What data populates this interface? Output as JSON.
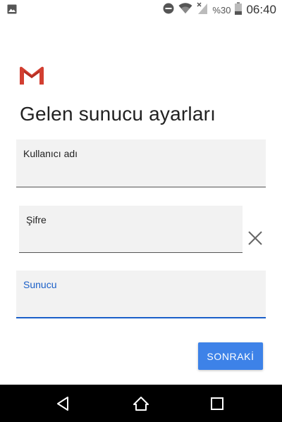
{
  "status_bar": {
    "battery_percent": "%30",
    "time": "06:40",
    "icons": [
      "image-icon",
      "do-not-disturb-icon",
      "wifi-icon",
      "no-signal-icon",
      "battery-icon"
    ]
  },
  "app": {
    "logo": "gmail-logo-icon"
  },
  "page": {
    "title": "Gelen sunucu ayarları"
  },
  "form": {
    "username": {
      "label": "Kullanıcı adı",
      "value": ""
    },
    "password": {
      "label": "Şifre",
      "value": ""
    },
    "server": {
      "label": "Sunucu",
      "value": ""
    },
    "clear_icon": "close-icon",
    "next_label": "SONRAKİ"
  },
  "nav_bar": {
    "icons": [
      "back-icon",
      "home-icon",
      "recents-icon"
    ]
  },
  "colors": {
    "accent": "#1a5fc8",
    "button": "#3d82e8",
    "field_bg": "#f2f2f2",
    "gmail_red": "#d23f31"
  }
}
